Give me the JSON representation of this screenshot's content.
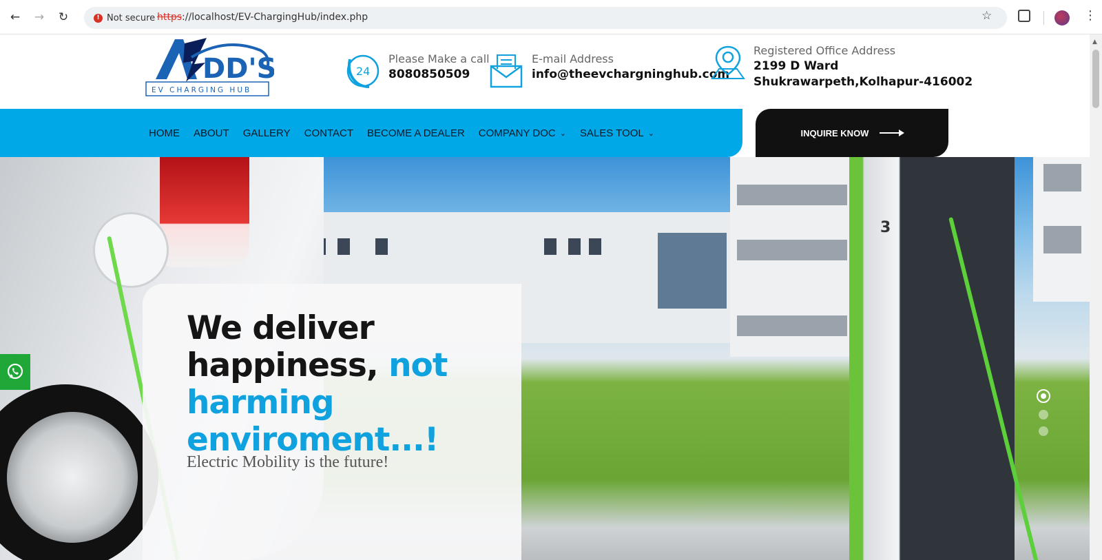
{
  "browser": {
    "security_label": "Not secure",
    "url_protocol": "https",
    "url_rest": "://localhost/EV-ChargingHub/index.php"
  },
  "header": {
    "logo_alt": "ADD'S EV CHARGING HUB",
    "phone": {
      "label": "Please Make a call",
      "value": "8080850509",
      "icon": "phone-24-icon"
    },
    "email": {
      "label": "E-mail Address",
      "value": "info@theevchargninghub.com",
      "icon": "mail-icon"
    },
    "address": {
      "label": "Registered Office Address",
      "line1": "2199 D Ward",
      "line2": "Shukrawarpeth,Kolhapur-416002",
      "icon": "map-pin-icon"
    }
  },
  "nav": {
    "items": [
      {
        "label": "HOME"
      },
      {
        "label": "ABOUT"
      },
      {
        "label": "GALLERY"
      },
      {
        "label": "CONTACT"
      },
      {
        "label": "BECOME A DEALER"
      },
      {
        "label": "COMPANY DOC"
      },
      {
        "label": "SALES TOOL"
      }
    ],
    "cta_label": "INQUIRE KNOW"
  },
  "hero": {
    "headline_dark": "We deliver happiness, ",
    "headline_blue": "not harming enviroment...!",
    "subline": "Electric Mobility is the future!",
    "charger_number": "3",
    "slides_total": 3,
    "slide_active": 1
  },
  "colors": {
    "nav_bg": "#00a8e8",
    "accent_blue": "#10a2de",
    "cta_bg": "#111111",
    "whatsapp_bg": "#1fa838"
  }
}
